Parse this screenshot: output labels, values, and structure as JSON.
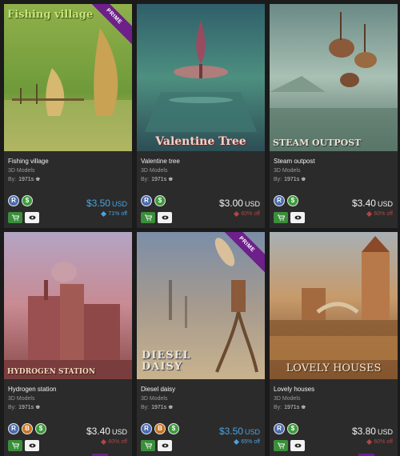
{
  "cards": [
    {
      "image_title": "Fishing village",
      "prime": true,
      "prime_label": "PRIME",
      "name": "Fishing village",
      "category": "3D Models",
      "by_label": "By:",
      "author": "1971s",
      "badges": [
        "R",
        "$"
      ],
      "price": "$3.50",
      "currency": "USD",
      "discount": "71% off",
      "price_color": "#4aa3e0"
    },
    {
      "image_title": "Valentine Tree",
      "prime": false,
      "name": "Valentine tree",
      "category": "3D Models",
      "by_label": "By:",
      "author": "1971s",
      "badges": [
        "R",
        "$"
      ],
      "price": "$3.00",
      "currency": "USD",
      "discount": "60% off",
      "price_color": "#f2f2f2"
    },
    {
      "image_title": "STEAM OUTPOST",
      "prime": false,
      "name": "Steam outpost",
      "category": "3D Models",
      "by_label": "By:",
      "author": "1971s",
      "badges": [
        "R",
        "$"
      ],
      "price": "$3.40",
      "currency": "USD",
      "discount": "60% off",
      "price_color": "#f2f2f2"
    },
    {
      "image_title": "HYDROGEN STATION",
      "prime": false,
      "name": "Hydrogen station",
      "category": "3D Models",
      "by_label": "By:",
      "author": "1971s",
      "badges": [
        "R",
        "B",
        "$"
      ],
      "price": "$3.40",
      "currency": "USD",
      "discount": "60% off",
      "price_color": "#f2f2f2"
    },
    {
      "image_title": "DIESEL DAISY",
      "prime": true,
      "prime_label": "PRIME",
      "name": "Diesel daisy",
      "category": "3D Models",
      "by_label": "By:",
      "author": "1971s",
      "badges": [
        "R",
        "B",
        "$"
      ],
      "price": "$3.50",
      "currency": "USD",
      "discount": "65% off",
      "price_color": "#4aa3e0"
    },
    {
      "image_title": "LOVELY HOUSES",
      "prime": false,
      "name": "Lovely houses",
      "category": "3D Models",
      "by_label": "By:",
      "author": "1971s",
      "badges": [
        "R",
        "$"
      ],
      "price": "$3.80",
      "currency": "USD",
      "discount": "60% off",
      "price_color": "#f2f2f2"
    }
  ]
}
